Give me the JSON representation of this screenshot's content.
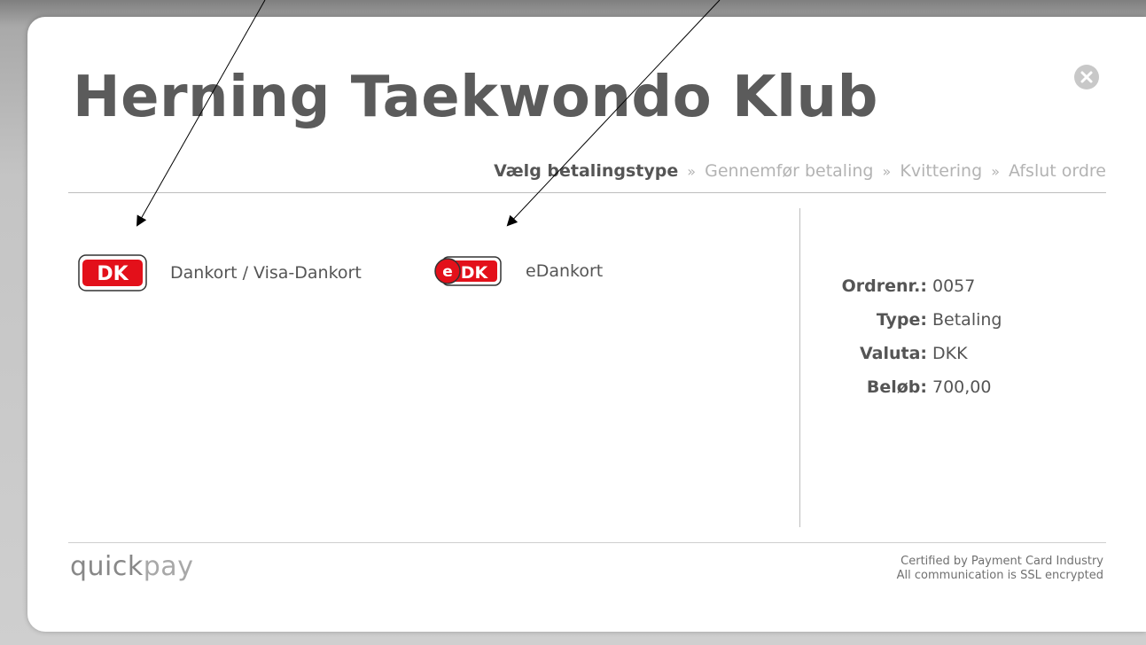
{
  "header": {
    "title": "Herning Taekwondo Klub"
  },
  "steps": {
    "step1": "Vælg betalingstype",
    "step2": "Gennemfør betaling",
    "step3": "Kvittering",
    "step4": "Afslut ordre",
    "separator": "»"
  },
  "payment_methods": [
    {
      "label": "Dankort / Visa-Dankort",
      "icon": "dankort-icon"
    },
    {
      "label": "eDankort",
      "icon": "edankort-icon"
    }
  ],
  "order": {
    "number_label": "Ordrenr.:",
    "number": "0057",
    "type_label": "Type:",
    "type": "Betaling",
    "currency_label": "Valuta:",
    "currency": "DKK",
    "amount_label": "Beløb:",
    "amount": "700,00"
  },
  "footer": {
    "brand_bold": "quick",
    "brand_light": "pay",
    "cert_line1": "Certified by Payment Card Industry",
    "cert_line2": "All communication is SSL encrypted"
  },
  "icons": {
    "close": "close-icon",
    "dankort": "dankort-icon",
    "edankort": "edankort-icon",
    "arrows": "annotation-arrow"
  },
  "colors": {
    "dk_red": "#e3101a",
    "text": "#555555",
    "muted": "#b3b3b3"
  }
}
